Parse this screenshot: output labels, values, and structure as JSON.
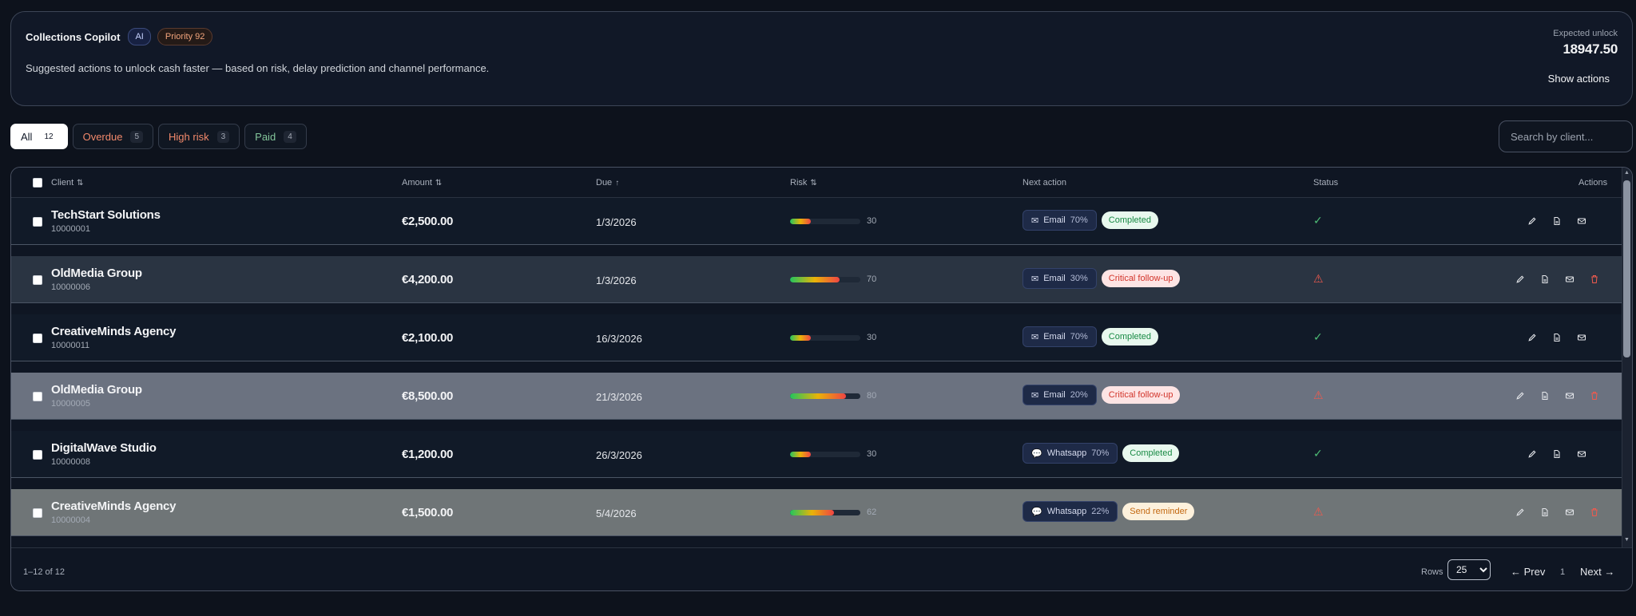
{
  "copilot": {
    "title": "Collections Copilot",
    "ai_badge": "AI",
    "priority_badge": "Priority 92",
    "subtitle": "Suggested actions to unlock cash faster — based on risk, delay prediction and channel performance.",
    "unlock_label": "Expected unlock",
    "unlock_value": "18947.50",
    "show_actions": "Show actions"
  },
  "filters": [
    {
      "label": "All",
      "count": "12"
    },
    {
      "label": "Overdue",
      "count": "5"
    },
    {
      "label": "High risk",
      "count": "3"
    },
    {
      "label": "Paid",
      "count": "4"
    }
  ],
  "search": {
    "placeholder": "Search by client..."
  },
  "table": {
    "headers": {
      "client": "Client",
      "amount": "Amount",
      "due": "Due",
      "risk": "Risk",
      "next_action": "Next action",
      "status": "Status",
      "actions": "Actions"
    },
    "rows": [
      {
        "name": "TechStart Solutions",
        "id": "10000001",
        "amount": "€2,500.00",
        "due": "1/3/2026",
        "risk": 30,
        "risk_label": "30",
        "channel": "Email",
        "channel_pct": "70%",
        "tag": "Completed",
        "tag_kind": "completed",
        "status": "ok",
        "deletable": false
      },
      {
        "name": "OldMedia Group",
        "id": "10000006",
        "amount": "€4,200.00",
        "due": "1/3/2026",
        "risk": 70,
        "risk_label": "70",
        "channel": "Email",
        "channel_pct": "30%",
        "tag": "Critical follow-up",
        "tag_kind": "critical",
        "status": "warn",
        "deletable": true
      },
      {
        "name": "CreativeMinds Agency",
        "id": "10000011",
        "amount": "€2,100.00",
        "due": "16/3/2026",
        "risk": 30,
        "risk_label": "30",
        "channel": "Email",
        "channel_pct": "70%",
        "tag": "Completed",
        "tag_kind": "completed",
        "status": "ok",
        "deletable": false
      },
      {
        "name": "OldMedia Group",
        "id": "10000005",
        "amount": "€8,500.00",
        "due": "21/3/2026",
        "risk": 80,
        "risk_label": "80",
        "channel": "Email",
        "channel_pct": "20%",
        "tag": "Critical follow-up",
        "tag_kind": "critical",
        "status": "warn",
        "deletable": true
      },
      {
        "name": "DigitalWave Studio",
        "id": "10000008",
        "amount": "€1,200.00",
        "due": "26/3/2026",
        "risk": 30,
        "risk_label": "30",
        "channel": "Whatsapp",
        "channel_pct": "70%",
        "tag": "Completed",
        "tag_kind": "completed",
        "status": "ok",
        "deletable": false
      },
      {
        "name": "CreativeMinds Agency",
        "id": "10000004",
        "amount": "€1,500.00",
        "due": "5/4/2026",
        "risk": 62,
        "risk_label": "62",
        "channel": "Whatsapp",
        "channel_pct": "22%",
        "tag": "Send reminder",
        "tag_kind": "reminder",
        "status": "warn",
        "deletable": true
      }
    ]
  },
  "footer": {
    "range": "1–12 of 12",
    "rows_label": "Rows",
    "rows_value": "25",
    "prev": "← Prev",
    "page": "1",
    "next": "Next →"
  },
  "colors": {
    "background": "#0d121c",
    "completed": "#188a44",
    "critical": "#d2352b",
    "reminder": "#c2670f"
  }
}
